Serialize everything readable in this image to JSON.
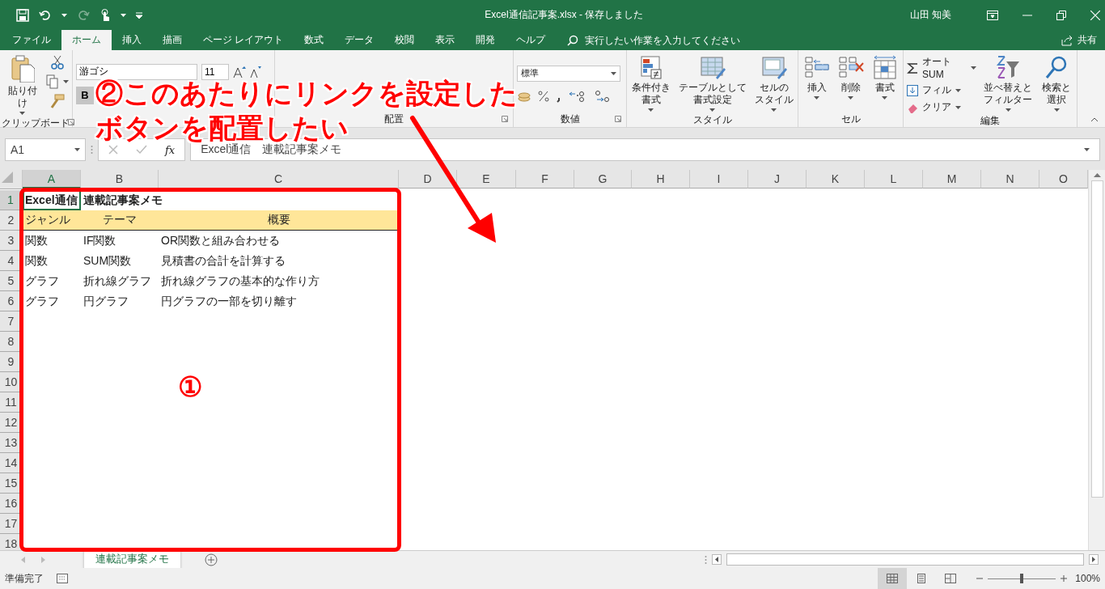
{
  "window": {
    "title": "Excel通信記事案.xlsx  -  保存しました",
    "user": "山田 知美"
  },
  "ribbon_tabs": [
    {
      "label": "ファイル",
      "selected": false
    },
    {
      "label": "ホーム",
      "selected": true
    },
    {
      "label": "挿入",
      "selected": false
    },
    {
      "label": "描画",
      "selected": false
    },
    {
      "label": "ページ レイアウト",
      "selected": false
    },
    {
      "label": "数式",
      "selected": false
    },
    {
      "label": "データ",
      "selected": false
    },
    {
      "label": "校閲",
      "selected": false
    },
    {
      "label": "表示",
      "selected": false
    },
    {
      "label": "開発",
      "selected": false
    },
    {
      "label": "ヘルプ",
      "selected": false
    }
  ],
  "tell_me": {
    "placeholder": "実行したい作業を入力してください"
  },
  "share": "共有",
  "ribbon_groups": [
    {
      "kind": "clipboard",
      "label": "クリップボード",
      "paste": "貼り付け"
    },
    {
      "kind": "font",
      "font_name": "游ゴシ",
      "font_size": "11",
      "bold": "B"
    },
    {
      "kind": "alignment",
      "label": "配置"
    },
    {
      "kind": "number",
      "label": "数値",
      "format": "標準"
    },
    {
      "kind": "styles",
      "label": "スタイル",
      "buttons": [
        {
          "lines": [
            "条件付き",
            "書式"
          ]
        },
        {
          "lines": [
            "テーブルとして",
            "書式設定"
          ]
        },
        {
          "lines": [
            "セルの",
            "スタイル"
          ]
        }
      ]
    },
    {
      "kind": "cells",
      "label": "セル",
      "buttons": [
        {
          "lines": [
            "挿入"
          ]
        },
        {
          "lines": [
            "削除"
          ]
        },
        {
          "lines": [
            "書式"
          ]
        }
      ]
    },
    {
      "kind": "editing",
      "label": "編集",
      "small_buttons": [
        {
          "label": "オート SUM"
        },
        {
          "label": "フィル"
        },
        {
          "label": "クリア"
        }
      ],
      "buttons": [
        {
          "lines": [
            "並べ替えと",
            "フィルター"
          ]
        },
        {
          "lines": [
            "検索と",
            "選択"
          ]
        }
      ]
    }
  ],
  "formula_bar": {
    "name_box": "A1",
    "function_label": "fx",
    "formula": "Excel通信　連載記事案メモ"
  },
  "columns": [
    {
      "label": "A",
      "selected": true
    },
    {
      "label": "B",
      "selected": false
    },
    {
      "label": "C",
      "selected": false
    },
    {
      "label": "D",
      "selected": false
    },
    {
      "label": "E",
      "selected": false
    },
    {
      "label": "F",
      "selected": false
    },
    {
      "label": "G",
      "selected": false
    },
    {
      "label": "H",
      "selected": false
    },
    {
      "label": "I",
      "selected": false
    },
    {
      "label": "J",
      "selected": false
    },
    {
      "label": "K",
      "selected": false
    },
    {
      "label": "L",
      "selected": false
    },
    {
      "label": "M",
      "selected": false
    },
    {
      "label": "N",
      "selected": false
    },
    {
      "label": "O",
      "selected": false
    }
  ],
  "rows": [
    {
      "number": "1",
      "selected": true,
      "kind": "title",
      "cells": [
        "Excel通信",
        "連載記事案メモ",
        ""
      ]
    },
    {
      "number": "2",
      "selected": false,
      "kind": "header",
      "cells": [
        "ジャンル",
        "テーマ",
        "概要"
      ]
    },
    {
      "number": "3",
      "selected": false,
      "kind": "data",
      "cells": [
        "関数",
        "IF関数",
        "OR関数と組み合わせる"
      ]
    },
    {
      "number": "4",
      "selected": false,
      "kind": "data",
      "cells": [
        "関数",
        "SUM関数",
        "見積書の合計を計算する"
      ]
    },
    {
      "number": "5",
      "selected": false,
      "kind": "data",
      "cells": [
        "グラフ",
        "折れ線グラフ",
        "折れ線グラフの基本的な作り方"
      ]
    },
    {
      "number": "6",
      "selected": false,
      "kind": "data",
      "cells": [
        "グラフ",
        "円グラフ",
        "円グラフの一部を切り離す"
      ]
    },
    {
      "number": "7",
      "selected": false,
      "kind": "empty"
    },
    {
      "number": "8",
      "selected": false,
      "kind": "empty"
    },
    {
      "number": "9",
      "selected": false,
      "kind": "empty"
    },
    {
      "number": "10",
      "selected": false,
      "kind": "empty"
    },
    {
      "number": "11",
      "selected": false,
      "kind": "empty"
    },
    {
      "number": "12",
      "selected": false,
      "kind": "empty"
    },
    {
      "number": "13",
      "selected": false,
      "kind": "empty"
    },
    {
      "number": "14",
      "selected": false,
      "kind": "empty"
    },
    {
      "number": "15",
      "selected": false,
      "kind": "empty"
    },
    {
      "number": "16",
      "selected": false,
      "kind": "empty"
    },
    {
      "number": "17",
      "selected": false,
      "kind": "empty"
    },
    {
      "number": "18",
      "selected": false,
      "kind": "empty"
    }
  ],
  "sheet_tabs": [
    {
      "label": "連載記事案メモ",
      "selected": true
    }
  ],
  "status_bar": {
    "status": "準備完了",
    "views": [
      {
        "selected": true
      },
      {
        "selected": false
      },
      {
        "selected": false
      }
    ],
    "zoom": {
      "level": 0.5,
      "reading": "100%"
    }
  },
  "annotations": {
    "callout": [
      "②このあたりにリンクを設定した",
      "ボタンを配置したい"
    ],
    "marker": "①"
  }
}
